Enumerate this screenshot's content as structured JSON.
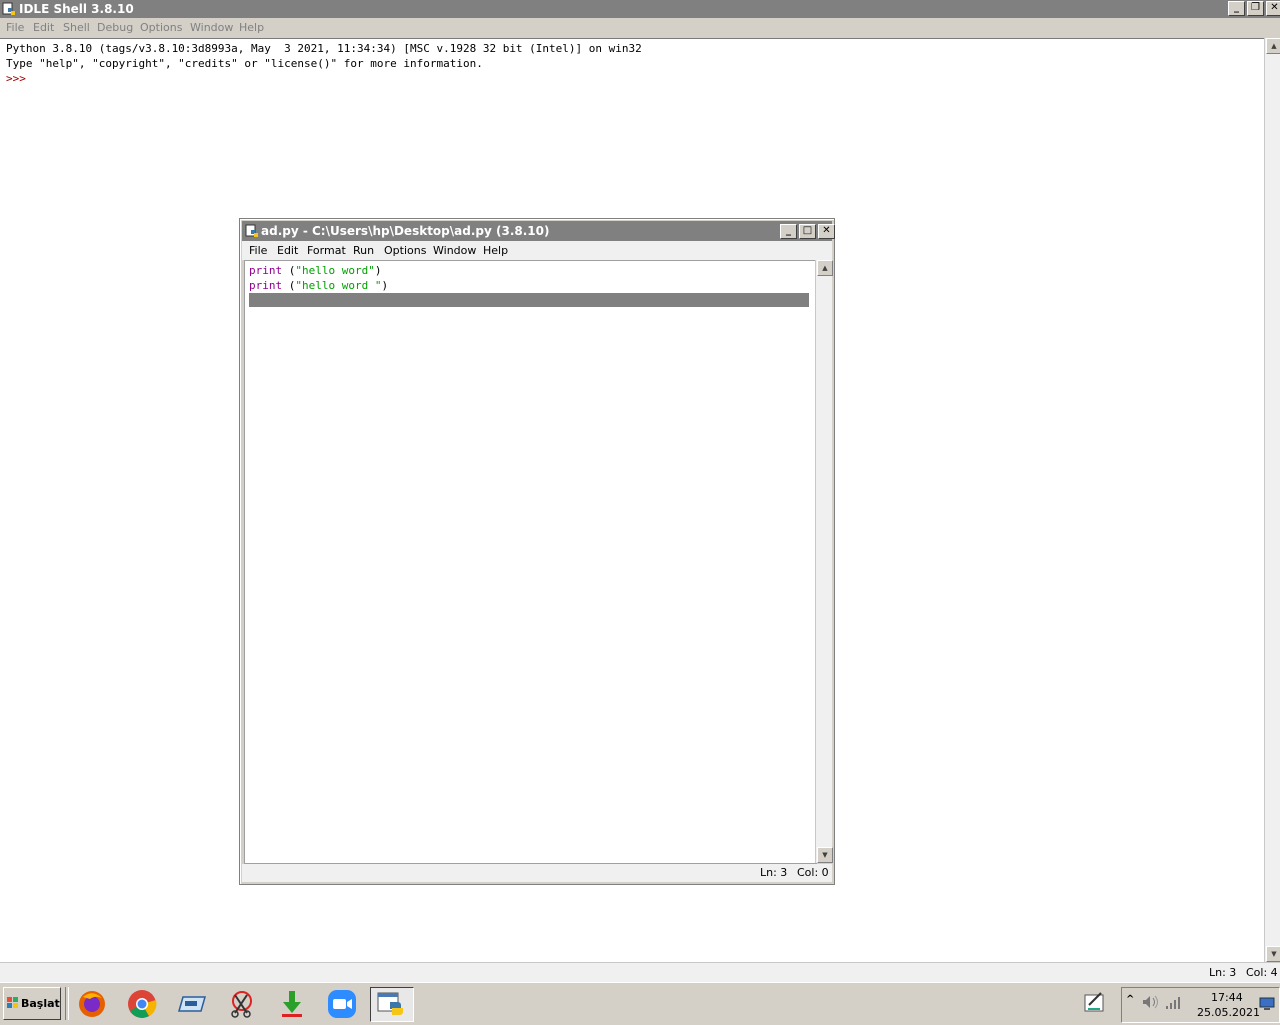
{
  "shell": {
    "title": "IDLE Shell 3.8.10",
    "menu": [
      "File",
      "Edit",
      "Shell",
      "Debug",
      "Options",
      "Window",
      "Help"
    ],
    "lines": [
      "Python 3.8.10 (tags/v3.8.10:3d8993a, May  3 2021, 11:34:34) [MSC v.1928 32 bit (Intel)] on win32",
      "Type \"help\", \"copyright\", \"credits\" or \"license()\" for more information."
    ],
    "prompt": ">>>",
    "status": {
      "ln": "Ln: 3",
      "col": "Col: 4"
    }
  },
  "editor": {
    "title": "ad.py - C:\\Users\\hp\\Desktop\\ad.py (3.8.10)",
    "menu": [
      "File",
      "Edit",
      "Format",
      "Run",
      "Options",
      "Window",
      "Help"
    ],
    "code": [
      {
        "kw": "print",
        "mid": " (",
        "str": "\"hello word\"",
        "end": ")"
      },
      {
        "kw": "print",
        "mid": " (",
        "str": "\"hello word \"",
        "end": ")"
      }
    ],
    "status": {
      "ln": "Ln: 3",
      "col": "Col: 0"
    }
  },
  "window_buttons": {
    "minimize": "_",
    "maximize": "□",
    "restore": "❐",
    "close": "✕"
  },
  "scroll_arrows": {
    "up": "▲",
    "down": "▼"
  },
  "taskbar": {
    "start_label": "Başlat",
    "apps": [
      "firefox-icon",
      "chrome-icon",
      "scanner-icon",
      "snipping-tool-icon",
      "download-icon",
      "zoom-icon",
      "python-idle-icon"
    ],
    "clock_time": "17:44",
    "clock_date": "25.05.2021",
    "tray_chevron": "^"
  },
  "colors": {
    "keyword": "#900090",
    "string": "#00a000",
    "prompt": "#a00000",
    "titlebar": "#808080"
  }
}
